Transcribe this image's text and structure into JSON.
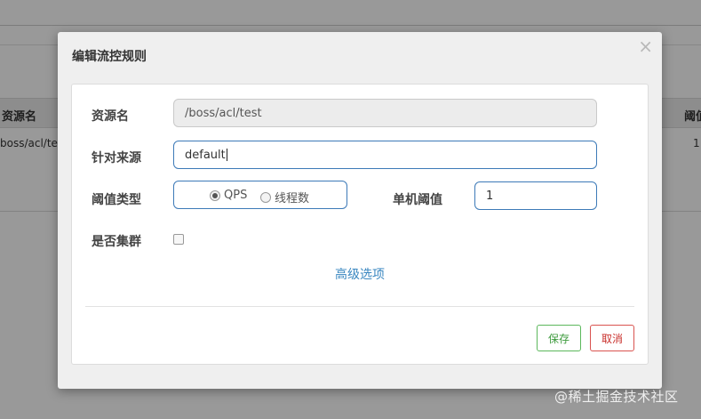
{
  "background": {
    "table": {
      "header_left": "资源名",
      "header_right": "阈值",
      "row_left": "boss/acl/test",
      "row_right": "1"
    }
  },
  "modal": {
    "title": "编辑流控规则",
    "close_glyph": "×",
    "resource": {
      "label": "资源名",
      "value": "/boss/acl/test"
    },
    "source": {
      "label": "针对来源",
      "value": "default"
    },
    "threshold_type": {
      "label": "阈值类型",
      "options": [
        {
          "label": "QPS",
          "selected": true
        },
        {
          "label": "线程数",
          "selected": false
        }
      ]
    },
    "single_threshold": {
      "label": "单机阈值",
      "value": "1"
    },
    "cluster": {
      "label": "是否集群",
      "checked": false
    },
    "advanced_link": "高级选项",
    "save_label": "保存",
    "cancel_label": "取消"
  },
  "watermark": "@稀土掘金技术社区",
  "colors": {
    "input_border": "#3d7ab8",
    "link": "#3a87c0",
    "save": "#5cb85c",
    "cancel": "#d9534f"
  }
}
